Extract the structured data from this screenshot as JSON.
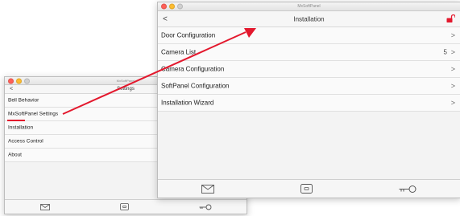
{
  "small_window": {
    "app_title": "MxSoftPanel",
    "back_glyph": "<",
    "nav_title": "Settings",
    "items": [
      {
        "label": "Bell Behavior"
      },
      {
        "label": "MxSoftPanel Settings"
      },
      {
        "label": "Installation"
      },
      {
        "label": "Access Control"
      },
      {
        "label": "About"
      }
    ],
    "tabbar": [
      {
        "icon": "mail-icon"
      },
      {
        "icon": "door-station-icon"
      },
      {
        "icon": "key-icon"
      }
    ]
  },
  "large_window": {
    "app_title": "MxSoftPanel",
    "back_glyph": "<",
    "nav_title": "Installation",
    "lock_icon": "unlocked-padlock-icon",
    "chevron_glyph": ">",
    "items": [
      {
        "label": "Door Configuration",
        "count": ""
      },
      {
        "label": "Camera List",
        "count": "5"
      },
      {
        "label": "Camera Configuration",
        "count": ""
      },
      {
        "label": "SoftPanel Configuration",
        "count": ""
      },
      {
        "label": "Installation Wizard",
        "count": ""
      }
    ],
    "tabbar": [
      {
        "icon": "mail-icon"
      },
      {
        "icon": "door-station-icon"
      },
      {
        "icon": "key-icon"
      }
    ]
  },
  "colors": {
    "accent_red": "#e3182d",
    "traffic_red": "#ff5f57",
    "traffic_yellow": "#febc2e"
  }
}
